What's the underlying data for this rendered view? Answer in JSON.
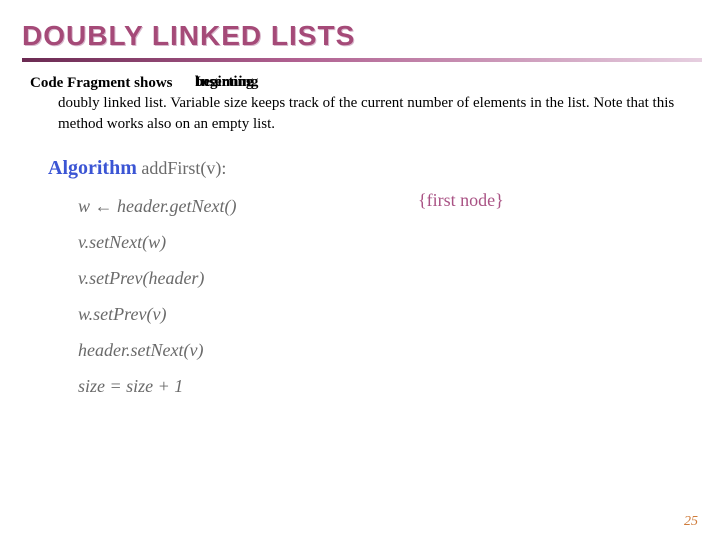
{
  "title": "DOUBLY LINKED LISTS",
  "body": {
    "lead": "Code Fragment shows",
    "overlap1": "Inserting",
    "overlap2": "beginning",
    "rest": "doubly linked list. Variable size keeps track of the current number of elements in the list. Note that this method works also on an empty list."
  },
  "algo": {
    "keyword": "Algorithm",
    "name": " addFirst(v):",
    "lines": [
      "w ← header.getNext()",
      "v.setNext(w)",
      "v.setPrev(header)",
      "w.setPrev(v)",
      "header.setNext(v)",
      "size = size + 1"
    ],
    "comment": "{first node}"
  },
  "page": "25"
}
